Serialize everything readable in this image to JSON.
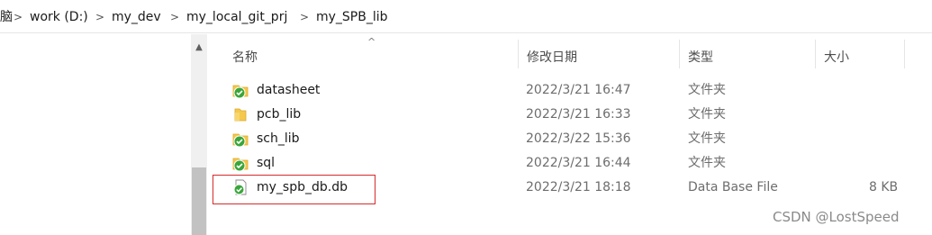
{
  "breadcrumb": {
    "partial_item": "脑",
    "items": [
      "work (D:)",
      "my_dev",
      "my_local_git_prj",
      "my_SPB_lib"
    ],
    "separator": ">"
  },
  "columns": {
    "name": "名称",
    "modified": "修改日期",
    "type": "类型",
    "size": "大小"
  },
  "files": [
    {
      "name": "datasheet",
      "modified": "2022/3/21 16:47",
      "type": "文件夹",
      "size": "",
      "icon": "folder-synced-icon"
    },
    {
      "name": "pcb_lib",
      "modified": "2022/3/21 16:33",
      "type": "文件夹",
      "size": "",
      "icon": "folder-icon"
    },
    {
      "name": "sch_lib",
      "modified": "2022/3/22 15:36",
      "type": "文件夹",
      "size": "",
      "icon": "folder-synced-icon"
    },
    {
      "name": "sql",
      "modified": "2022/3/21 16:44",
      "type": "文件夹",
      "size": "",
      "icon": "folder-synced-icon"
    },
    {
      "name": "my_spb_db.db",
      "modified": "2022/3/21 18:18",
      "type": "Data Base File",
      "size": "8 KB",
      "icon": "file-synced-icon"
    }
  ],
  "watermark": "CSDN @LostSpeed",
  "colors": {
    "highlight": "#d62b2b",
    "folder": "#f5c84c",
    "sync_badge": "#3aa63a"
  }
}
